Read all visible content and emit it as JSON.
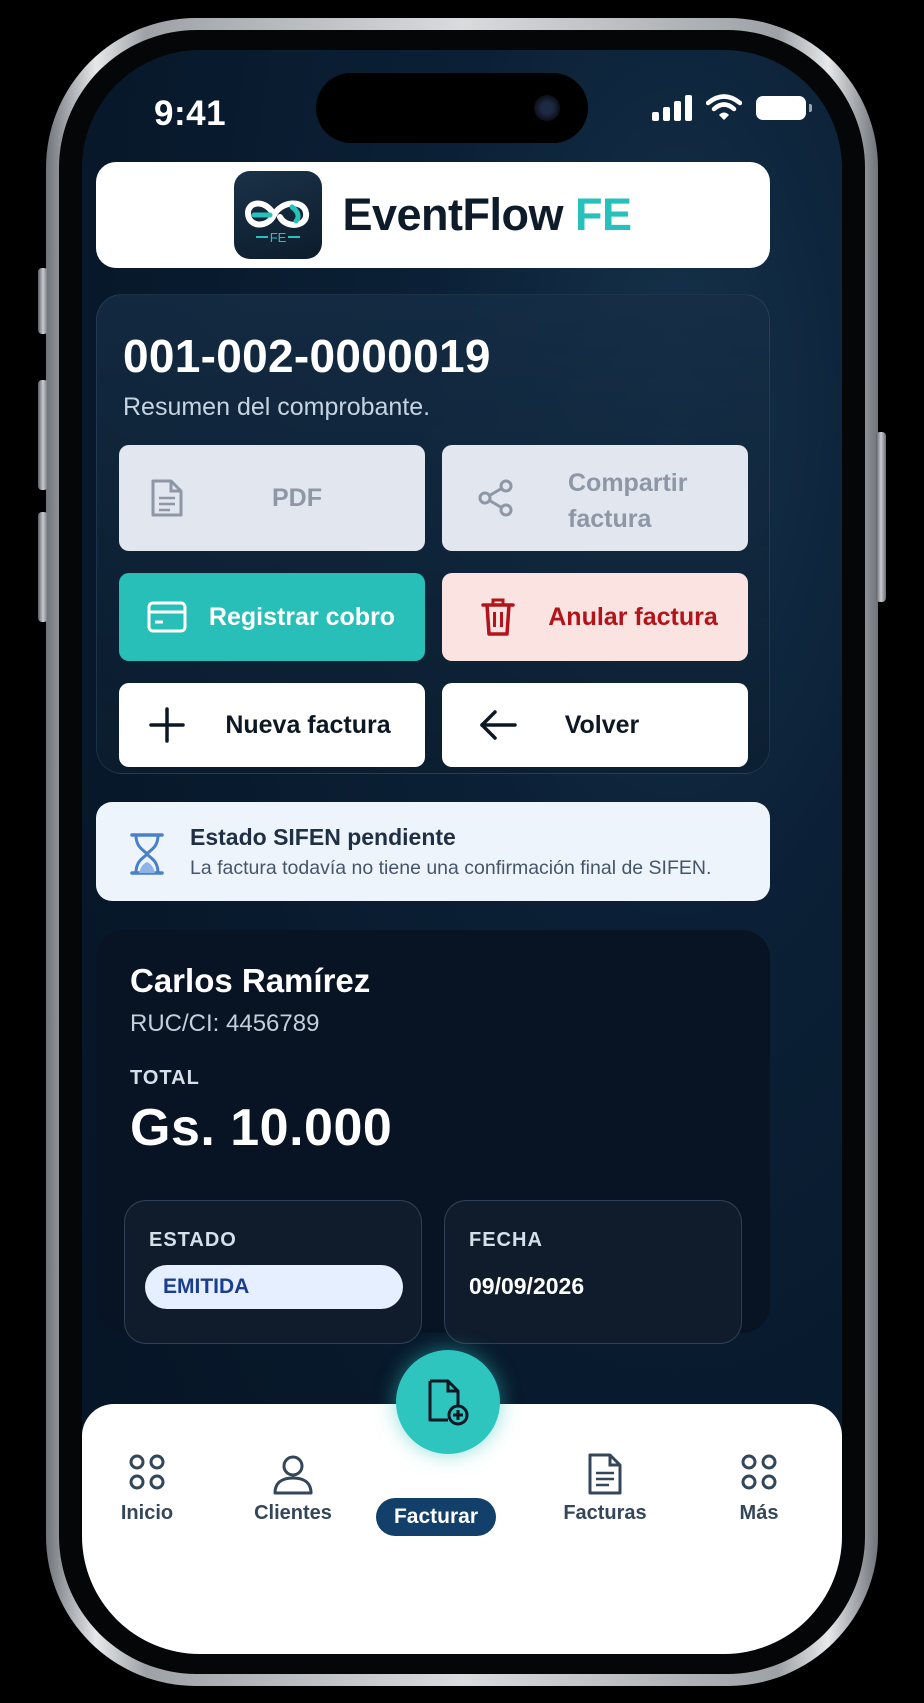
{
  "status_bar": {
    "time": "9:41"
  },
  "brand": {
    "name": "EventFlow",
    "suffix": "FE",
    "logo_text": "FE"
  },
  "invoice": {
    "number": "001-002-0000019",
    "subtitle": "Resumen del comprobante."
  },
  "actions": {
    "pdf": {
      "label": "PDF",
      "icon": "document-icon"
    },
    "share": {
      "label_line1": "Compartir",
      "label_line2": "factura",
      "icon": "share-icon"
    },
    "register_payment": {
      "label": "Registrar cobro",
      "icon": "credit-card-icon"
    },
    "void_invoice": {
      "label": "Anular factura",
      "icon": "trash-icon"
    },
    "new_invoice": {
      "label": "Nueva factura",
      "icon": "plus-icon"
    },
    "back": {
      "label": "Volver",
      "icon": "arrow-left-icon"
    }
  },
  "notice": {
    "title": "Estado SIFEN pendiente",
    "text": "La factura todavía no tiene una confirmación final de SIFEN.",
    "icon": "hourglass-icon"
  },
  "client": {
    "name": "Carlos Ramírez",
    "ruc": "RUC/CI: 4456789",
    "total_label": "TOTAL",
    "total_value": "Gs. 10.000",
    "status_label": "ESTADO",
    "status_value": "EMITIDA",
    "date_label": "FECHA",
    "date_value": "09/09/2026"
  },
  "nav": {
    "items": [
      {
        "label": "Inicio",
        "icon": "grid-dots-icon"
      },
      {
        "label": "Clientes",
        "icon": "user-icon"
      },
      {
        "label": "Facturar",
        "icon": "add-document-icon",
        "active": true
      },
      {
        "label": "Facturas",
        "icon": "document-list-icon"
      },
      {
        "label": "Más",
        "icon": "grid-dots-icon"
      }
    ]
  },
  "colors": {
    "accent": "#27bfb8",
    "danger": "#b3141a",
    "background": "#07182a",
    "nav_active": "#13406a"
  }
}
